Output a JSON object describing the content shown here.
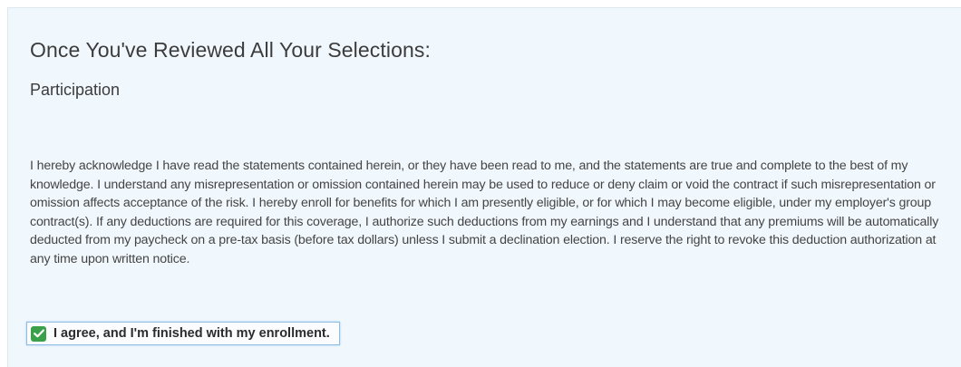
{
  "section": {
    "title": "Once You've Reviewed All Your Selections:",
    "subtitle": "Participation",
    "acknowledgement": "I hereby acknowledge I have read the statements contained herein, or they have been read to me, and the statements are true and complete to the best of my knowledge. I understand any misrepresentation or omission contained herein may be used to reduce or deny claim or void the contract if such misrepresentation or omission affects acceptance of the risk. I hereby enroll for benefits for which I am presently eligible, or for which I may become eligible, under my employer's group contract(s). If any deductions are required for this coverage, I authorize such deductions from my earnings and I understand that any premiums will be automatically deducted from my paycheck on a pre-tax basis (before tax dollars) unless I submit a declination election. I reserve the right to revoke this deduction authorization at any time upon written notice."
  },
  "agreement": {
    "label": "I agree, and I'm finished with my enrollment.",
    "checked": true,
    "check_color": "#3aa04a",
    "icon": "checkmark-icon"
  },
  "colors": {
    "panel_background": "#f1f8fd",
    "focus_border": "#8fbde6"
  }
}
